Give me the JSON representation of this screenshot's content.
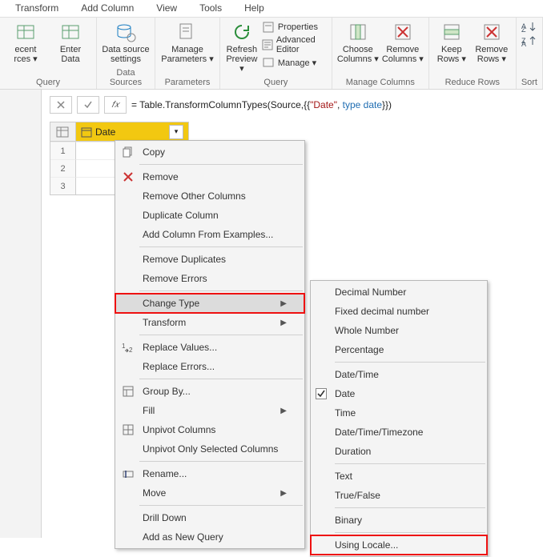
{
  "tabs": [
    "Transform",
    "Add Column",
    "View",
    "Tools",
    "Help"
  ],
  "ribbon": {
    "groups": [
      {
        "label": "Query",
        "big": [
          {
            "name": "recent-sources",
            "label1": "ecent",
            "label2": "rces ▾"
          },
          {
            "name": "enter-data",
            "label1": "Enter",
            "label2": "Data"
          }
        ]
      },
      {
        "label": "Data Sources",
        "big": [
          {
            "name": "data-source-settings",
            "label1": "Data source",
            "label2": "settings"
          }
        ]
      },
      {
        "label": "Parameters",
        "big": [
          {
            "name": "manage-parameters",
            "label1": "Manage",
            "label2": "Parameters ▾"
          }
        ]
      },
      {
        "label": "Query",
        "big": [
          {
            "name": "refresh-preview",
            "label1": "Refresh",
            "label2": "Preview ▾"
          }
        ],
        "small": [
          {
            "name": "properties",
            "label": "Properties"
          },
          {
            "name": "advanced-editor",
            "label": "Advanced Editor"
          },
          {
            "name": "manage",
            "label": "Manage ▾"
          }
        ]
      },
      {
        "label": "Manage Columns",
        "big": [
          {
            "name": "choose-columns",
            "label1": "Choose",
            "label2": "Columns ▾"
          },
          {
            "name": "remove-columns",
            "label1": "Remove",
            "label2": "Columns ▾"
          }
        ]
      },
      {
        "label": "Reduce Rows",
        "big": [
          {
            "name": "keep-rows",
            "label1": "Keep",
            "label2": "Rows ▾"
          },
          {
            "name": "remove-rows",
            "label1": "Remove",
            "label2": "Rows ▾"
          }
        ]
      },
      {
        "label": "Sort",
        "big": [],
        "sort": true
      }
    ]
  },
  "formula": {
    "prefix": "= Table.TransformColumnTypes(Source,{{",
    "str": "\"Date\"",
    "mid": ", ",
    "kw": "type date",
    "suffix": "}})"
  },
  "column": {
    "name": "Date"
  },
  "rows": [
    "1",
    "2",
    "3"
  ],
  "contextMenu": {
    "sections": [
      [
        {
          "icon": "copy-icon",
          "label": "Copy"
        }
      ],
      [
        {
          "icon": "remove-icon",
          "label": "Remove"
        },
        {
          "label": "Remove Other Columns"
        },
        {
          "label": "Duplicate Column"
        },
        {
          "label": "Add Column From Examples..."
        }
      ],
      [
        {
          "label": "Remove Duplicates"
        },
        {
          "label": "Remove Errors"
        }
      ],
      [
        {
          "label": "Change Type",
          "arrow": true,
          "selected": true,
          "highlight": true
        },
        {
          "label": "Transform",
          "arrow": true
        }
      ],
      [
        {
          "icon": "replace-icon",
          "label": "Replace Values..."
        },
        {
          "label": "Replace Errors..."
        }
      ],
      [
        {
          "icon": "group-icon",
          "label": "Group By..."
        },
        {
          "label": "Fill",
          "arrow": true
        },
        {
          "icon": "unpivot-icon",
          "label": "Unpivot Columns"
        },
        {
          "label": "Unpivot Only Selected Columns"
        }
      ],
      [
        {
          "icon": "rename-icon",
          "label": "Rename..."
        },
        {
          "label": "Move",
          "arrow": true
        }
      ],
      [
        {
          "label": "Drill Down"
        },
        {
          "label": "Add as New Query"
        }
      ]
    ]
  },
  "subMenu": {
    "sections": [
      [
        {
          "label": "Decimal Number"
        },
        {
          "label": "Fixed decimal number"
        },
        {
          "label": "Whole Number"
        },
        {
          "label": "Percentage"
        }
      ],
      [
        {
          "label": "Date/Time"
        },
        {
          "label": "Date",
          "checked": true
        },
        {
          "label": "Time"
        },
        {
          "label": "Date/Time/Timezone"
        },
        {
          "label": "Duration"
        }
      ],
      [
        {
          "label": "Text"
        },
        {
          "label": "True/False"
        }
      ],
      [
        {
          "label": "Binary"
        }
      ],
      [
        {
          "label": "Using Locale...",
          "highlight": true
        }
      ]
    ]
  }
}
